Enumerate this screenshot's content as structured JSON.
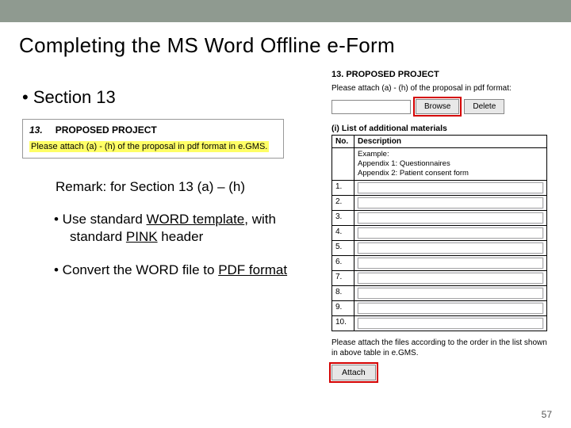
{
  "title": "Completing the MS Word Offline e-Form",
  "left": {
    "section_label": "•   Section 13",
    "doc_number": "13.",
    "doc_heading": "PROPOSED PROJECT",
    "doc_instruction": "Please attach (a) - (h) of the proposal in pdf format in e.GMS.",
    "remark": "Remark: for Section 13 (a) – (h)",
    "bullet1_pre": "•   Use standard ",
    "bullet1_u1": "WORD template",
    "bullet1_comma": ",",
    "bullet1_mid": " with standard ",
    "bullet1_u2": "PINK",
    "bullet1_post": " header",
    "bullet2_pre": "•   Convert the WORD file to ",
    "bullet2_u": "PDF format"
  },
  "right": {
    "heading": "13. PROPOSED PROJECT",
    "subheading": "Please attach (a) - (h) of the proposal in pdf format:",
    "browse": "Browse",
    "delete": "Delete",
    "list_heading": "(i) List of additional materials",
    "col_no": "No.",
    "col_desc": "Description",
    "example_l1": "Example:",
    "example_l2": "Appendix 1: Questionnaires",
    "example_l3": "Appendix 2: Patient consent form",
    "rows": [
      "1.",
      "2.",
      "3.",
      "4.",
      "5.",
      "6.",
      "7.",
      "8.",
      "9.",
      "10."
    ],
    "note": "Please attach the files according to the order in the list shown in above table in e.GMS.",
    "attach": "Attach"
  },
  "page_number": "57"
}
